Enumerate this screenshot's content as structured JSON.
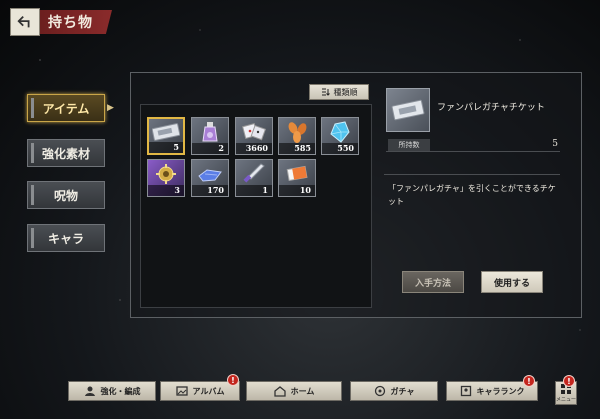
{
  "header": {
    "back_icon": "back-arrow-icon",
    "title": "持ち物"
  },
  "side_tabs": [
    {
      "label": "アイテム",
      "active": true
    },
    {
      "label": "強化素材",
      "active": false
    },
    {
      "label": "呪物",
      "active": false
    },
    {
      "label": "キャラ",
      "active": false
    }
  ],
  "sort_button": {
    "label": "種類順",
    "icon": "sort-icon"
  },
  "items": [
    {
      "name": "ticket",
      "qty": "5",
      "selected": true,
      "icon": "ticket-icon",
      "color": "#d8dde4"
    },
    {
      "name": "potion",
      "qty": "2",
      "selected": false,
      "icon": "potion-icon",
      "color": "#b08ad8"
    },
    {
      "name": "dice",
      "qty": "3660",
      "selected": false,
      "icon": "dice-icon",
      "color": "#e8e8f0"
    },
    {
      "name": "leaves",
      "qty": "585",
      "selected": false,
      "icon": "leaf-icon",
      "color": "#e08a3c"
    },
    {
      "name": "crystal",
      "qty": "550",
      "selected": false,
      "icon": "crystal-icon",
      "color": "#58c8f0"
    },
    {
      "name": "mecha",
      "qty": "3",
      "selected": false,
      "icon": "golden-gear-icon",
      "color": "#d8b04a"
    },
    {
      "name": "blue-cloth",
      "qty": "170",
      "selected": false,
      "icon": "cloth-icon",
      "color": "#6a8ae8"
    },
    {
      "name": "knife",
      "qty": "1",
      "selected": false,
      "icon": "knife-icon",
      "color": "#e0e4ec"
    },
    {
      "name": "card",
      "qty": "10",
      "selected": false,
      "icon": "card-icon",
      "color": "#f0803c"
    }
  ],
  "detail": {
    "name": "ファンパレガチャチケット",
    "own_label": "所持数",
    "own_value": "5",
    "description": "「ファンパレガチャ」を引くことができるチケット",
    "acquire_label": "入手方法",
    "use_label": "使用する"
  },
  "bottom_nav": [
    {
      "label": "強化・編成",
      "icon": "enhance-icon",
      "alert": false
    },
    {
      "label": "アルバム",
      "icon": "album-icon",
      "alert": true
    },
    {
      "label": "ホーム",
      "icon": "home-icon",
      "alert": false
    },
    {
      "label": "ガチャ",
      "icon": "gacha-icon",
      "alert": false
    },
    {
      "label": "キャラランク",
      "icon": "rank-icon",
      "alert": true
    }
  ],
  "menu": {
    "label": "メニュー",
    "alert": true,
    "alert_mark": "!"
  }
}
